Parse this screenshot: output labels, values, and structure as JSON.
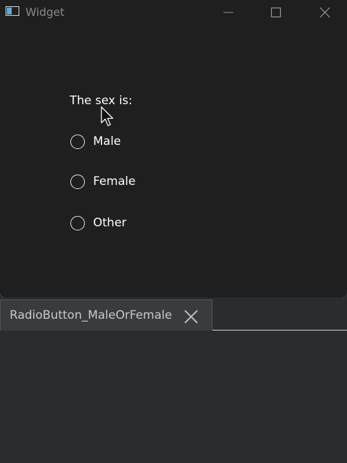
{
  "window": {
    "title": "Widget",
    "icon": "app-window-icon",
    "controls": [
      "minimize-icon",
      "maximize-icon",
      "close-icon"
    ]
  },
  "form": {
    "prompt": "The sex is:",
    "options": [
      {
        "label": "Male",
        "checked": false
      },
      {
        "label": "Female",
        "checked": false
      },
      {
        "label": "Other",
        "checked": false
      }
    ]
  },
  "tabs": [
    {
      "label": "RadioButton_MaleOrFemale",
      "icon": "close-icon"
    }
  ],
  "colors": {
    "window_bg": "#1f1f1f",
    "page_bg": "#2b2c2e",
    "text": "#ffffff",
    "title_text": "#8a8a8a"
  }
}
